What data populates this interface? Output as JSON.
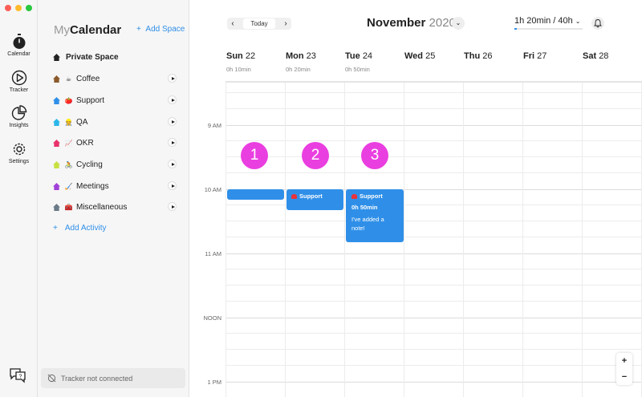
{
  "window": {
    "traffic_lights": [
      "#fd5f57",
      "#febb2e",
      "#29c840"
    ]
  },
  "rail": {
    "items": [
      {
        "label": "Calendar",
        "icon": "stopwatch-icon"
      },
      {
        "label": "Tracker",
        "icon": "play-circle-icon"
      },
      {
        "label": "Insights",
        "icon": "pie-chart-icon"
      },
      {
        "label": "Settings",
        "icon": "gear-icon"
      }
    ],
    "help_icon": "help-chat-icon"
  },
  "sidebar": {
    "title_prefix": "My",
    "title": "Calendar",
    "add_space": "Add Space",
    "space_name": "Private Space",
    "activities": [
      {
        "label": "Coffee",
        "emoji": "☕",
        "color": "#8b5a2b"
      },
      {
        "label": "Support",
        "emoji": "🍅",
        "color": "#2f8fe8"
      },
      {
        "label": "QA",
        "emoji": "👷",
        "color": "#2bb6e8"
      },
      {
        "label": "OKR",
        "emoji": "📈",
        "color": "#e8326b"
      },
      {
        "label": "Cycling",
        "emoji": "🚴",
        "color": "#c8e040"
      },
      {
        "label": "Meetings",
        "emoji": "🏑",
        "color": "#a040d8"
      },
      {
        "label": "Miscellaneous",
        "emoji": "🧰",
        "color": "#6a7a88"
      }
    ],
    "add_activity": "Add Activity",
    "tracker_status": "Tracker not connected"
  },
  "topbar": {
    "today": "Today",
    "month": "November",
    "year": "2020",
    "goal": "1h 20min / 40h",
    "goal_progress_pct": 3.3
  },
  "days": [
    {
      "name": "Sun",
      "num": "22",
      "duration": "0h 10min"
    },
    {
      "name": "Mon",
      "num": "23",
      "duration": "0h 20min"
    },
    {
      "name": "Tue",
      "num": "24",
      "duration": "0h 50min"
    },
    {
      "name": "Wed",
      "num": "25",
      "duration": ""
    },
    {
      "name": "Thu",
      "num": "26",
      "duration": ""
    },
    {
      "name": "Fri",
      "num": "27",
      "duration": ""
    },
    {
      "name": "Sat",
      "num": "28",
      "duration": ""
    }
  ],
  "time_labels": [
    "9 AM",
    "10 AM",
    "11 AM",
    "NOON",
    "1 PM"
  ],
  "events": [
    {
      "day": "Sun",
      "title": "",
      "duration": "",
      "note": ""
    },
    {
      "day": "Mon",
      "title": "Support",
      "duration": "",
      "note": ""
    },
    {
      "day": "Tue",
      "title": "Support",
      "duration": "0h 50min",
      "note": "I've added a note!"
    }
  ],
  "markers": [
    "1",
    "2",
    "3"
  ],
  "zoom": {
    "in": "+",
    "out": "−"
  },
  "colors": {
    "accent": "#2f8fe8",
    "marker": "#ea3fe0"
  }
}
